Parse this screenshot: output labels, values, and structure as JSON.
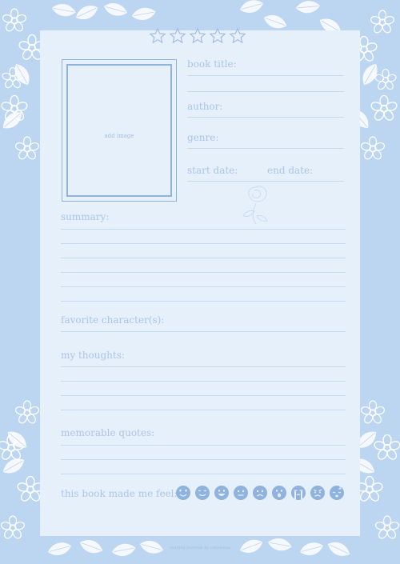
{
  "rating_stars": 5,
  "photo": {
    "label": "add image"
  },
  "fields": {
    "book_title": "book title:",
    "author": "author:",
    "genre": "genre:",
    "start_date": "start date:",
    "end_date": "end date:"
  },
  "sections": {
    "summary": "summary:",
    "favorite_characters": "favorite character(s):",
    "my_thoughts": "my thoughts:",
    "memorable_quotes": "memorable quotes:",
    "feelings": "this book made me feel:"
  },
  "feelings_icons": [
    "heart-eyes-icon",
    "smiling-icon",
    "grinning-icon",
    "neutral-icon",
    "sad-icon",
    "surprised-icon",
    "crying-icon",
    "angry-icon",
    "sleepy-icon"
  ],
  "footer": "reading journals by canvasina",
  "colors": {
    "background": "#bcd5f0",
    "card": "#e6f0fb",
    "accent": "#8fb2de",
    "text": "#a9c5ea"
  }
}
